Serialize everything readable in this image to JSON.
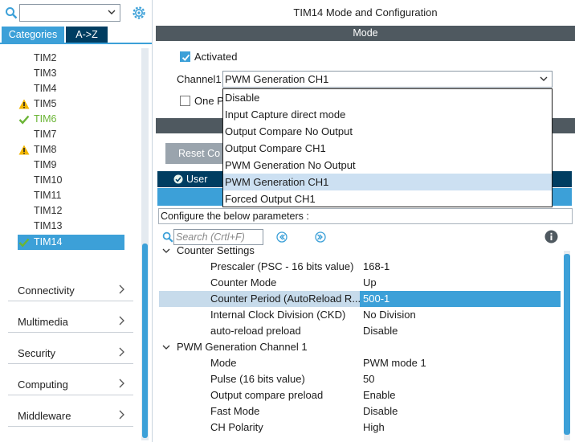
{
  "window": {
    "title": "TIM14 Mode and Configuration"
  },
  "sidebar": {
    "search": {
      "value": ""
    },
    "tabs": {
      "categories": "Categories",
      "az": "A->Z"
    },
    "items": [
      {
        "label": "TIM2",
        "status": ""
      },
      {
        "label": "TIM3",
        "status": ""
      },
      {
        "label": "TIM4",
        "status": ""
      },
      {
        "label": "TIM5",
        "status": "warning"
      },
      {
        "label": "TIM6",
        "status": "ok"
      },
      {
        "label": "TIM7",
        "status": ""
      },
      {
        "label": "TIM8",
        "status": "warning"
      },
      {
        "label": "TIM9",
        "status": ""
      },
      {
        "label": "TIM10",
        "status": ""
      },
      {
        "label": "TIM11",
        "status": ""
      },
      {
        "label": "TIM12",
        "status": ""
      },
      {
        "label": "TIM13",
        "status": ""
      },
      {
        "label": "TIM14",
        "status": "ok",
        "selected": true
      }
    ],
    "groups": [
      "Connectivity",
      "Multimedia",
      "Security",
      "Computing",
      "Middleware"
    ]
  },
  "mode": {
    "header": "Mode",
    "activated_label": "Activated",
    "activated_checked": true,
    "channel_label": "Channel1",
    "channel_value": "PWM Generation CH1",
    "one_pulse_label": "One P",
    "one_pulse_checked": false
  },
  "dropdown": {
    "options": [
      "Disable",
      "Input Capture direct mode",
      "Output Compare No Output",
      "Output Compare CH1",
      "PWM Generation No Output",
      "PWM Generation CH1",
      "Forced Output CH1"
    ],
    "highlighted_index": 5
  },
  "configuration": {
    "reset_label": "Reset Co",
    "user_tab_label": "User",
    "configure_label": "Configure the below parameters :",
    "search_placeholder": "Search (Crtl+F)"
  },
  "params": {
    "counter_group": "Counter Settings",
    "counter_rows": [
      {
        "name": "Prescaler (PSC - 16 bits value)",
        "value": "168-1"
      },
      {
        "name": "Counter Mode",
        "value": "Up"
      },
      {
        "name": "Counter Period (AutoReload R...",
        "value": "500-1",
        "selected": true
      },
      {
        "name": "Internal Clock Division (CKD)",
        "value": "No Division"
      },
      {
        "name": "auto-reload preload",
        "value": "Disable"
      }
    ],
    "pwm_group": "PWM Generation Channel 1",
    "pwm_rows": [
      {
        "name": "Mode",
        "value": "PWM mode 1"
      },
      {
        "name": "Pulse (16 bits value)",
        "value": "50"
      },
      {
        "name": "Output compare preload",
        "value": "Enable"
      },
      {
        "name": "Fast Mode",
        "value": "Disable"
      },
      {
        "name": "CH Polarity",
        "value": "High"
      }
    ]
  },
  "colors": {
    "accent": "#3ca0d8",
    "navy": "#003d61",
    "bar": "#4f5960",
    "warning": "#f2b600",
    "ok": "#6bb536"
  }
}
